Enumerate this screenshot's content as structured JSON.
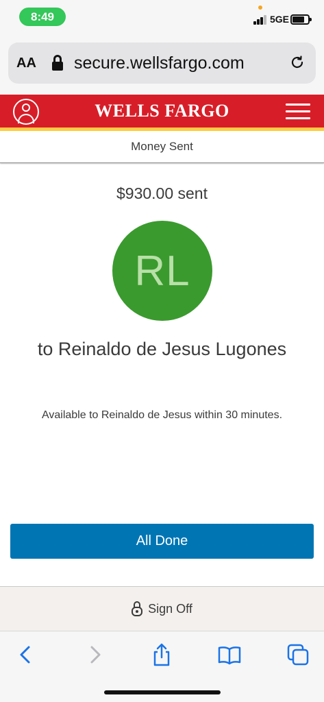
{
  "status_bar": {
    "time": "8:49",
    "network": "5GE"
  },
  "browser": {
    "text_size_label": "AA",
    "url": "secure.wellsfargo.com"
  },
  "header": {
    "brand": "WELLS FARGO",
    "page_title": "Money Sent"
  },
  "confirmation": {
    "amount_text": "$930.00 sent",
    "avatar_initials": "RL",
    "recipient_text": "to Reinaldo de Jesus Lugones",
    "availability_text": "Available to Reinaldo de Jesus within 30 minutes."
  },
  "actions": {
    "done_label": "All Done"
  },
  "footer": {
    "sign_off_label": "Sign Off"
  },
  "colors": {
    "brand_red": "#d71e28",
    "brand_gold": "#ffcd41",
    "avatar_green": "#3a9a2e",
    "button_blue": "#0075b4",
    "ios_blue": "#1a73e8"
  },
  "icons": {
    "status": [
      "signal-icon",
      "battery-icon"
    ],
    "browser": [
      "lock-icon",
      "reload-icon"
    ],
    "header": [
      "user-icon",
      "menu-icon"
    ],
    "footer": [
      "padlock-icon"
    ],
    "toolbar": [
      "back-icon",
      "forward-icon",
      "share-icon",
      "bookmarks-icon",
      "tabs-icon"
    ]
  }
}
